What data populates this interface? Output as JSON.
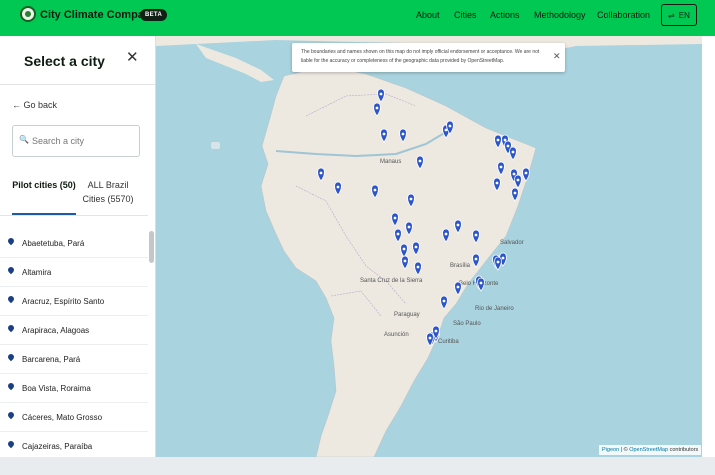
{
  "header": {
    "brand": "City Climate Compass",
    "badge": "BETA",
    "nav": [
      "About",
      "Cities",
      "Actions",
      "Methodology",
      "Collaboration"
    ],
    "lang": "EN",
    "accent": "#00c853"
  },
  "sidebar": {
    "title": "Select a city",
    "go_back": "← Go back",
    "search_placeholder": "Search a city",
    "tabs": [
      "Pilot cities (50)",
      "ALL Brazil Cities (5570)"
    ],
    "cities": [
      "Abaetetuba, Pará",
      "Altamira",
      "Aracruz, Espírito Santo",
      "Arapiraca, Alagoas",
      "Barcarena, Pará",
      "Boa Vista, Roraima",
      "Cáceres, Mato Grosso",
      "Cajazeiras, Paraíba"
    ]
  },
  "map": {
    "disclaimer": "The boundaries and names shown on this map do not imply official endorsement or acceptance. We are not liable for the accuracy or completeness of the geographic data provided by OpenStreetMap.",
    "labels": [
      "Manaus",
      "Salvador",
      "Brasília",
      "Belo Horizonte",
      "Rio de Janeiro",
      "São Paulo",
      "Curitiba",
      "Santa Cruz de la Sierra",
      "Asunción",
      "Paraguay"
    ],
    "attribution_pigeon": "Pigeon",
    "attribution_sep": " | © ",
    "attribution_osm": "OpenStreetMap",
    "attribution_tail": " contributors",
    "marker_color": "#2b55c8"
  }
}
